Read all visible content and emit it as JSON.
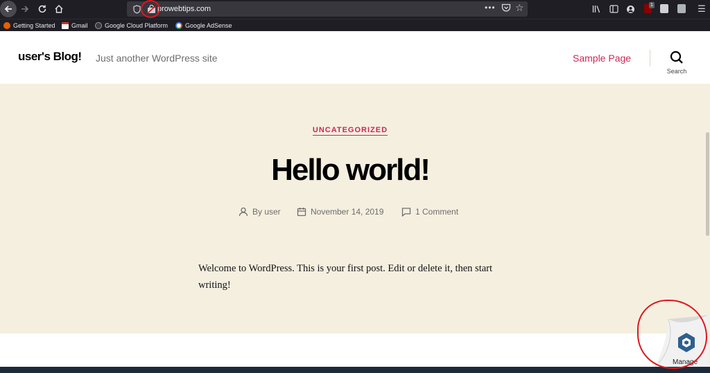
{
  "browser": {
    "url": "prowebtips.com",
    "bookmarks": [
      {
        "label": "Getting Started",
        "icon": "firefox-icon"
      },
      {
        "label": "Gmail",
        "icon": "gmail-icon"
      },
      {
        "label": "Google Cloud Platform",
        "icon": "gcp-icon"
      },
      {
        "label": "Google AdSense",
        "icon": "google-icon"
      }
    ],
    "ublock_count": "1",
    "colors": {
      "chrome": "#1f1e25",
      "urlbar": "#38373d"
    }
  },
  "site": {
    "title": "user's Blog!",
    "description": "Just another WordPress site",
    "nav": {
      "sample_page": "Sample Page"
    },
    "search_label": "Search",
    "colors": {
      "accent": "#cd2653",
      "hero_bg": "#f5efe0"
    }
  },
  "post": {
    "category": "UNCATEGORIZED",
    "title": "Hello world!",
    "meta": {
      "author": "By user",
      "date": "November 14, 2019",
      "comments": "1 Comment"
    },
    "body": "Welcome to WordPress. This is your first post. Edit or delete it, then start writing!"
  },
  "manage": {
    "label": "Manage"
  },
  "annotations": {
    "color": "#e0151d"
  }
}
